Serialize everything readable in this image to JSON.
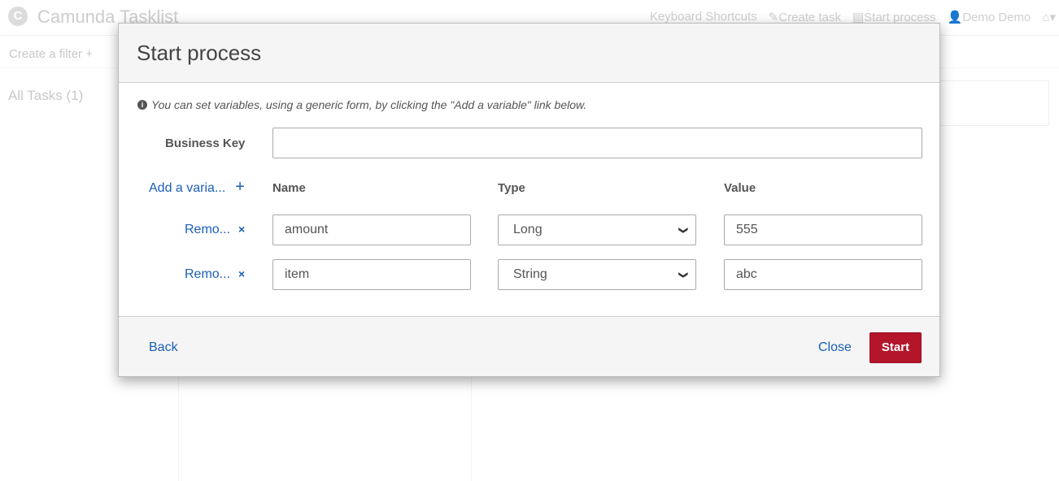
{
  "app": {
    "title": "Camunda Tasklist",
    "logo": "C",
    "nav": [
      "Keyboard Shortcuts",
      "Create task",
      "Start process",
      "Demo Demo"
    ],
    "create_filter": "Create a filter +",
    "all_tasks": "All Tasks (1)"
  },
  "modal": {
    "title": "Start process",
    "info": "You can set variables, using a generic form, by clicking the \"Add a variable\" link below.",
    "business_key_label": "Business Key",
    "business_key_value": "",
    "add_variable": "Add a varia...",
    "add_icon": "+",
    "columns": {
      "name": "Name",
      "type": "Type",
      "value": "Value"
    },
    "variables": [
      {
        "remove": "Remo...",
        "name": "amount",
        "type": "Long",
        "value": "555"
      },
      {
        "remove": "Remo...",
        "name": "item",
        "type": "String",
        "value": "abc"
      }
    ],
    "back": "Back",
    "close": "Close",
    "start": "Start"
  },
  "colors": {
    "link": "#1b5fb8",
    "primary": "#b5152b"
  }
}
